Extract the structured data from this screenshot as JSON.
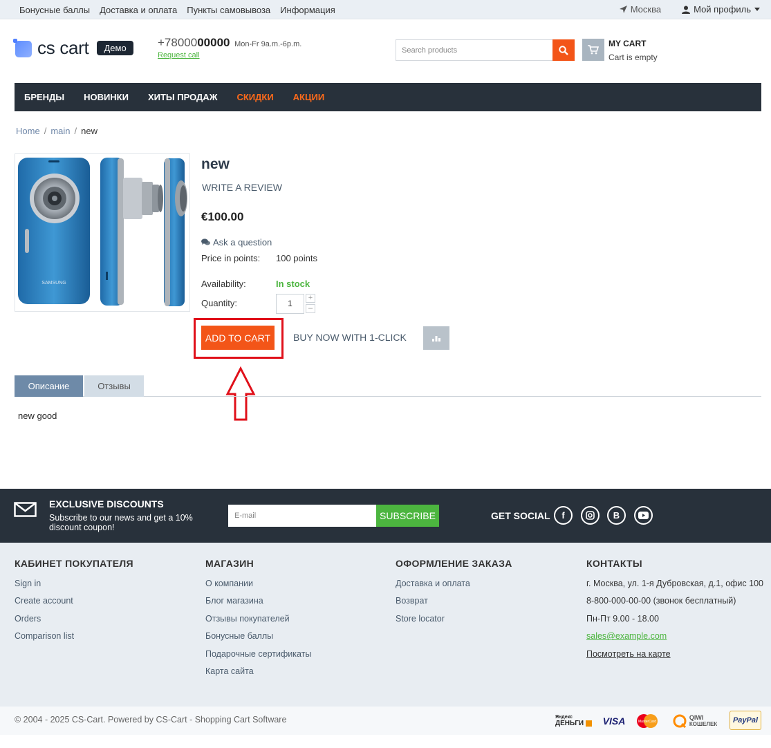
{
  "topbar": {
    "links": [
      "Бонусные баллы",
      "Доставка и оплата",
      "Пункты самовывоза",
      "Информация"
    ],
    "city": "Москва",
    "profile": "Мой профиль"
  },
  "header": {
    "logo_text": "cs cart",
    "logo_badge": "Демо",
    "phone_prefix": "+78000",
    "phone_bold": "00000",
    "hours": "Mon-Fr 9a.m.-6p.m.",
    "request_call": "Request call",
    "search_placeholder": "Search products",
    "cart_title": "MY CART",
    "cart_status": "Cart is empty"
  },
  "nav": {
    "items": [
      {
        "label": "БРЕНДЫ",
        "hot": false
      },
      {
        "label": "НОВИНКИ",
        "hot": false
      },
      {
        "label": "ХИТЫ ПРОДАЖ",
        "hot": false
      },
      {
        "label": "СКИДКИ",
        "hot": true
      },
      {
        "label": "АКЦИИ",
        "hot": true
      }
    ]
  },
  "breadcrumb": [
    "Home",
    "main",
    "new"
  ],
  "product": {
    "title": "new",
    "write_review": "WRITE A REVIEW",
    "price": "€100.00",
    "ask_question": "Ask a question",
    "points_label": "Price in points:",
    "points_value": "100 points",
    "availability_label": "Availability:",
    "availability_value": "In stock",
    "quantity_label": "Quantity:",
    "quantity_value": "1",
    "add_to_cart": "ADD TO CART",
    "buy_now": "BUY NOW WITH 1-CLICK",
    "image_brand": "SAMSUNG"
  },
  "tabs": {
    "description": "Описание",
    "reviews": "Отзывы",
    "content": "new good"
  },
  "subscribe": {
    "heading": "EXCLUSIVE DISCOUNTS",
    "text": "Subscribe to our news and get a 10% discount coupon!",
    "email_placeholder": "E-mail",
    "button": "SUBSCRIBE",
    "social_heading": "GET SOCIAL"
  },
  "footer": {
    "col1": {
      "title": "КАБИНЕТ ПОКУПАТЕЛЯ",
      "links": [
        "Sign in",
        "Create account",
        "Orders",
        "Comparison list"
      ]
    },
    "col2": {
      "title": "МАГАЗИН",
      "links": [
        "О компании",
        "Блог магазина",
        "Отзывы покупателей",
        "Бонусные баллы",
        "Подарочные сертификаты",
        "Карта сайта"
      ]
    },
    "col3": {
      "title": "ОФОРМЛЕНИЕ ЗАКАЗА",
      "links": [
        "Доставка и оплата",
        "Возврат",
        "Store locator"
      ]
    },
    "col4": {
      "title": "КОНТАКТЫ",
      "address": "г. Москва, ул. 1-я Дубровская, д.1, офис 100",
      "phone": "8-800-000-00-00 (звонок бесплатный)",
      "hours": "Пн-Пт 9.00 - 18.00",
      "email": "sales@example.com",
      "map": "Посмотреть на карте"
    },
    "copyright": "© 2004 - 2025 CS-Cart.  Powered by CS-Cart - Shopping Cart Software",
    "payments": {
      "yandex_top": "Яндекс",
      "yandex_bottom": "ДЕНЬГИ",
      "visa": "VISA",
      "mastercard": "MasterCard",
      "qiwi_top": "QIWI",
      "qiwi_bottom": "КОШЕЛЕК",
      "paypal": "PayPal"
    }
  },
  "colors": {
    "accent_orange": "#f35518",
    "dark_nav": "#28313b",
    "green": "#4cb53f",
    "highlight_red": "#e0101a"
  }
}
